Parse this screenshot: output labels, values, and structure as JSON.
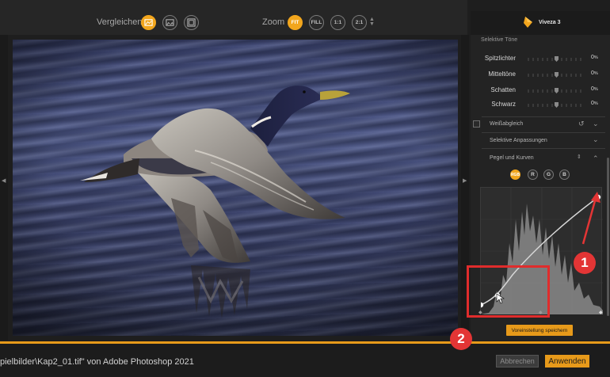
{
  "toolbar": {
    "compare_label": "Vergleichen",
    "zoom_label": "Zoom",
    "zoom_options": [
      "FIT",
      "FILL",
      "1:1",
      "2:1"
    ]
  },
  "panel": {
    "app_name": "Viveza 3",
    "selective_tones_title": "Selektive Töne",
    "tones": [
      {
        "label": "Spitzlichter",
        "value": "0",
        "unit": "%"
      },
      {
        "label": "Mitteltöne",
        "value": "0",
        "unit": "%"
      },
      {
        "label": "Schatten",
        "value": "0",
        "unit": "%"
      },
      {
        "label": "Schwarz",
        "value": "0",
        "unit": "%"
      }
    ],
    "white_balance_label": "Weißabgleich",
    "selective_adjustments_label": "Selektive Anpassungen",
    "levels_curves_label": "Pegel und Kurven",
    "channels": [
      "RGB",
      "R",
      "G",
      "B"
    ],
    "save_preset_label": "Voreinstellung speichern"
  },
  "bottom": {
    "filename_text": "pielbilder\\Kap2_01.tif\" von Adobe Photoshop 2021",
    "cancel_label": "Abbrechen",
    "apply_label": "Anwenden"
  },
  "annotations": {
    "marker_1": "1",
    "marker_2": "2"
  },
  "colors": {
    "accent": "#e79a1a",
    "annotation": "#e33535"
  }
}
